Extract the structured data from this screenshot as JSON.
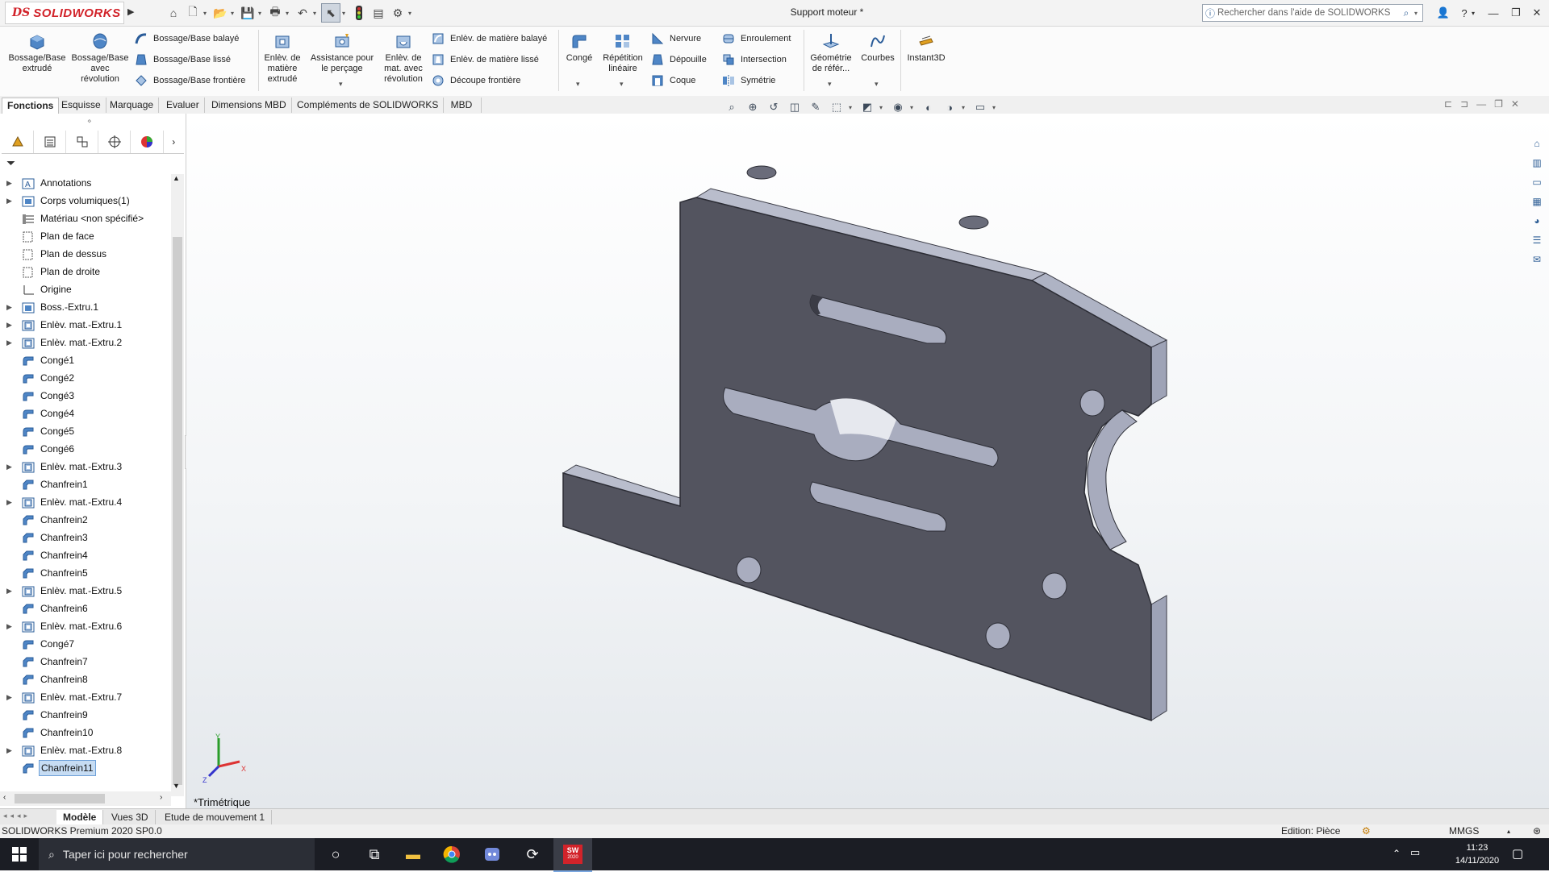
{
  "app": {
    "logo_ds": "DS",
    "logo_name": "SOLIDWORKS",
    "doc_title": "Support moteur *",
    "search_placeholder": "Rechercher dans l'aide de SOLIDWORKS"
  },
  "quick_access": {
    "icons": [
      "home-icon",
      "new-document-icon",
      "open-icon",
      "save-icon",
      "print-icon",
      "undo-icon",
      "select-arrow-icon",
      "traffic-light-icon",
      "file-properties-icon",
      "options-gear-icon"
    ]
  },
  "ribbon": {
    "big_buttons": [
      {
        "id": "boss-extrude",
        "label": "Bossage/Base\nextrudé"
      },
      {
        "id": "boss-revolve",
        "label": "Bossage/Base\navec\nrévolution"
      },
      {
        "id": "cut-extrude",
        "label": "Enlèv. de\nmatière\nextrudé"
      },
      {
        "id": "hole-wizard",
        "label": "Assistance pour\nle perçage"
      },
      {
        "id": "cut-revolve",
        "label": "Enlèv. de\nmat. avec\nrévolution"
      },
      {
        "id": "fillet",
        "label": "Congé"
      },
      {
        "id": "linear-pattern",
        "label": "Répétition\nlinéaire"
      },
      {
        "id": "ref-geometry",
        "label": "Géométrie\nde référ..."
      },
      {
        "id": "curves",
        "label": "Courbes"
      },
      {
        "id": "instant3d",
        "label": "Instant3D"
      }
    ],
    "small_buttons": [
      {
        "id": "boss-sweep",
        "label": "Bossage/Base balayé"
      },
      {
        "id": "boss-loft",
        "label": "Bossage/Base lissé"
      },
      {
        "id": "boss-boundary",
        "label": "Bossage/Base frontière"
      },
      {
        "id": "cut-sweep",
        "label": "Enlèv. de matière balayé"
      },
      {
        "id": "cut-loft",
        "label": "Enlèv. de matière lissé"
      },
      {
        "id": "cut-boundary",
        "label": "Découpe frontière"
      },
      {
        "id": "rib",
        "label": "Nervure"
      },
      {
        "id": "draft",
        "label": "Dépouille"
      },
      {
        "id": "shell",
        "label": "Coque"
      },
      {
        "id": "wrap",
        "label": "Enroulement"
      },
      {
        "id": "intersect",
        "label": "Intersection"
      },
      {
        "id": "mirror",
        "label": "Symétrie"
      }
    ]
  },
  "command_tabs": [
    "Fonctions",
    "Esquisse",
    "Marquage",
    "Evaluer",
    "Dimensions MBD",
    "Compléments de SOLIDWORKS",
    "MBD"
  ],
  "tree": [
    {
      "label": "Annotations",
      "expand": true,
      "icon": "annotations-icon"
    },
    {
      "label": "Corps volumiques(1)",
      "expand": true,
      "icon": "solid-bodies-icon"
    },
    {
      "label": "Matériau <non spécifié>",
      "expand": false,
      "icon": "material-icon"
    },
    {
      "label": "Plan de face",
      "expand": false,
      "icon": "plane-icon"
    },
    {
      "label": "Plan de dessus",
      "expand": false,
      "icon": "plane-icon"
    },
    {
      "label": "Plan de droite",
      "expand": false,
      "icon": "plane-icon"
    },
    {
      "label": "Origine",
      "expand": false,
      "icon": "origin-icon"
    },
    {
      "label": "Boss.-Extru.1",
      "expand": true,
      "icon": "extrude-icon"
    },
    {
      "label": "Enlèv. mat.-Extru.1",
      "expand": true,
      "icon": "cut-extrude-icon"
    },
    {
      "label": "Enlèv. mat.-Extru.2",
      "expand": true,
      "icon": "cut-extrude-icon"
    },
    {
      "label": "Congé1",
      "expand": false,
      "icon": "fillet-icon"
    },
    {
      "label": "Congé2",
      "expand": false,
      "icon": "fillet-icon"
    },
    {
      "label": "Congé3",
      "expand": false,
      "icon": "fillet-icon"
    },
    {
      "label": "Congé4",
      "expand": false,
      "icon": "fillet-icon"
    },
    {
      "label": "Congé5",
      "expand": false,
      "icon": "fillet-icon"
    },
    {
      "label": "Congé6",
      "expand": false,
      "icon": "fillet-icon"
    },
    {
      "label": "Enlèv. mat.-Extru.3",
      "expand": true,
      "icon": "cut-extrude-icon"
    },
    {
      "label": "Chanfrein1",
      "expand": false,
      "icon": "chamfer-icon"
    },
    {
      "label": "Enlèv. mat.-Extru.4",
      "expand": true,
      "icon": "cut-extrude-icon"
    },
    {
      "label": "Chanfrein2",
      "expand": false,
      "icon": "chamfer-icon"
    },
    {
      "label": "Chanfrein3",
      "expand": false,
      "icon": "chamfer-icon"
    },
    {
      "label": "Chanfrein4",
      "expand": false,
      "icon": "chamfer-icon"
    },
    {
      "label": "Chanfrein5",
      "expand": false,
      "icon": "chamfer-icon"
    },
    {
      "label": "Enlèv. mat.-Extru.5",
      "expand": true,
      "icon": "cut-extrude-icon"
    },
    {
      "label": "Chanfrein6",
      "expand": false,
      "icon": "chamfer-icon"
    },
    {
      "label": "Enlèv. mat.-Extru.6",
      "expand": true,
      "icon": "cut-extrude-icon"
    },
    {
      "label": "Congé7",
      "expand": false,
      "icon": "fillet-icon"
    },
    {
      "label": "Chanfrein7",
      "expand": false,
      "icon": "chamfer-icon"
    },
    {
      "label": "Chanfrein8",
      "expand": false,
      "icon": "chamfer-icon"
    },
    {
      "label": "Enlèv. mat.-Extru.7",
      "expand": true,
      "icon": "cut-extrude-icon"
    },
    {
      "label": "Chanfrein9",
      "expand": false,
      "icon": "chamfer-icon"
    },
    {
      "label": "Chanfrein10",
      "expand": false,
      "icon": "chamfer-icon"
    },
    {
      "label": "Enlèv. mat.-Extru.8",
      "expand": true,
      "icon": "cut-extrude-icon"
    },
    {
      "label": "Chanfrein11",
      "expand": false,
      "icon": "chamfer-icon",
      "selected": true
    }
  ],
  "viewport": {
    "view_name": "*Trimétrique",
    "axis_x": "X",
    "axis_y": "Y",
    "axis_z": "Z"
  },
  "bottom_tabs": [
    "Modèle",
    "Vues 3D",
    "Etude de mouvement 1"
  ],
  "status": {
    "left": "SOLIDWORKS Premium 2020 SP0.0",
    "edition": "Edition: Pièce",
    "units": "MMGS"
  },
  "taskbar": {
    "search_placeholder": "Taper ici pour rechercher",
    "sw_badge": "SW",
    "sw_year": "2020",
    "time": "11:23",
    "date": "14/11/2020"
  },
  "colors": {
    "brand_red": "#d2232a",
    "part_face": "#53545f",
    "part_side": "#b7bbc9",
    "selection": "#c6dcf3",
    "taskbar": "#1b1d24"
  }
}
